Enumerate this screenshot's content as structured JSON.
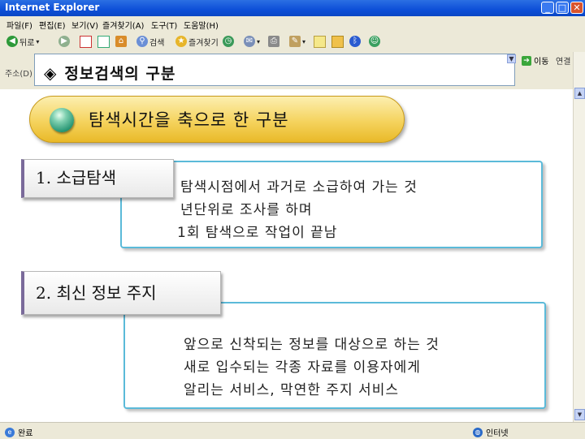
{
  "window": {
    "title": "Internet Explorer",
    "btn_min": "_",
    "btn_max": "□",
    "btn_close": "✕"
  },
  "menu": [
    "파일(F)",
    "편집(E)",
    "보기(V)",
    "즐겨찾기(A)",
    "도구(T)",
    "도움말(H)"
  ],
  "toolbar": {
    "back_label": "뒤로",
    "search_label": "검색",
    "favorites_label": "즐겨찾기"
  },
  "address": {
    "label": "주소(D)",
    "go_label": "이동",
    "links_label": "연결",
    "more_glyph": "»"
  },
  "slide": {
    "heading": "정보검색의 구분",
    "heading_glyph": "◈",
    "banner": "탐색시간을 축으로 한 구분",
    "sections": [
      {
        "label": "1. 소급탐색",
        "lines": [
          "탐색시점에서 과거로 소급하여 가는 것",
          "년단위로 조사를 하며",
          "1회 탐색으로 작업이 끝남"
        ]
      },
      {
        "label": "2. 최신 정보 주지",
        "lines": [
          "앞으로 신착되는 정보를 대상으로 하는 것",
          "새로 입수되는 각종 자료를 이용자에게",
          "알리는 서비스, 막연한 주지 서비스"
        ]
      }
    ]
  },
  "status": {
    "left": "완료",
    "right": "인터넷"
  },
  "colors": {
    "titlebar": "#0d4fd8",
    "banner": "#f5d35e",
    "box_border": "#5bbad9"
  },
  "icons": [
    "back-icon",
    "forward-icon",
    "stop-icon",
    "refresh-icon",
    "home-icon",
    "search-icon",
    "favorites-icon",
    "history-icon",
    "mail-icon",
    "print-icon",
    "edit-icon",
    "bluetooth-icon",
    "messenger-icon"
  ]
}
